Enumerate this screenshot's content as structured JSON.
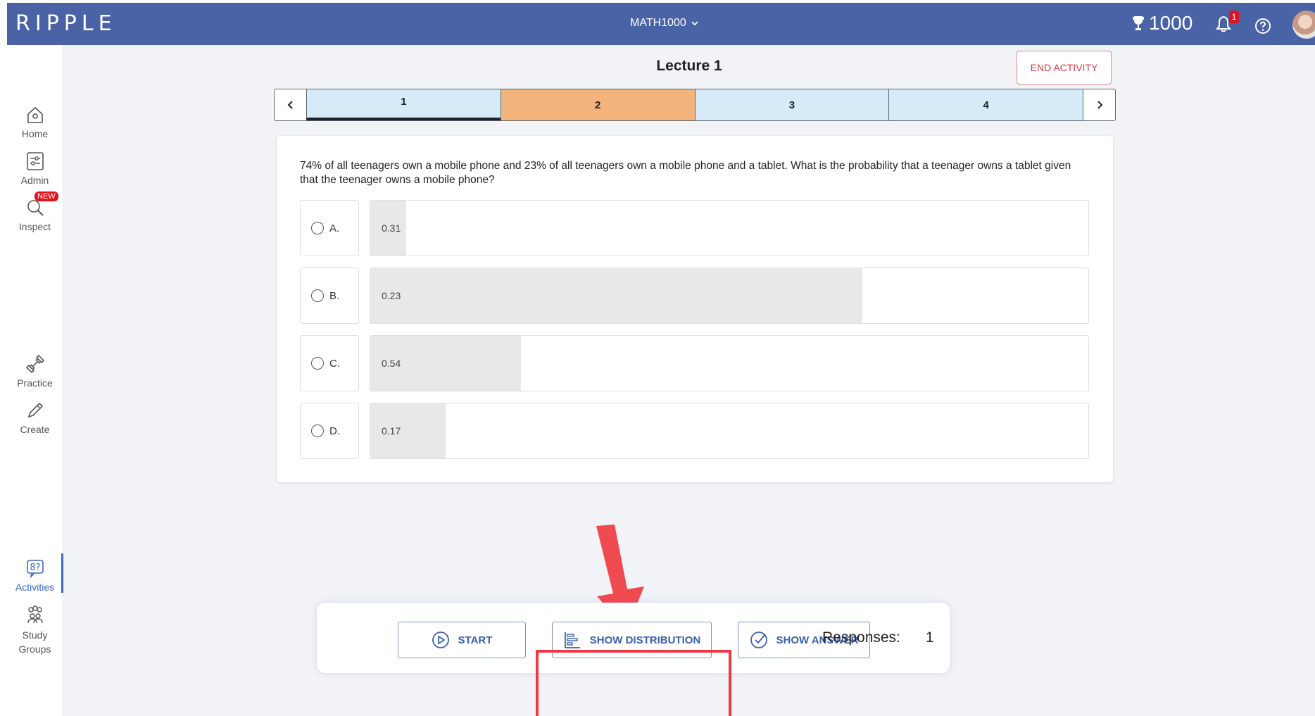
{
  "header": {
    "logo": "RIPPLE",
    "course": "MATH1000",
    "points": "1000",
    "notification_count": "1"
  },
  "sidebar": {
    "items": [
      {
        "label": "Home",
        "icon": "home-icon"
      },
      {
        "label": "Admin",
        "icon": "admin-icon"
      },
      {
        "label": "Inspect",
        "icon": "inspect-icon",
        "badge": "NEW"
      },
      {
        "label": "Practice",
        "icon": "practice-icon"
      },
      {
        "label": "Create",
        "icon": "create-icon"
      },
      {
        "label": "Activities",
        "icon": "activities-icon",
        "active": true
      },
      {
        "label": "Study Groups",
        "icon": "study-groups-icon"
      }
    ]
  },
  "main": {
    "title": "Lecture 1",
    "end_activity": "END ACTIVITY",
    "question_tabs": [
      "1",
      "2",
      "3",
      "4"
    ],
    "current_tab": "2",
    "question_text": "74% of all teenagers own a mobile phone and 23% of all teenagers own a mobile phone and a tablet. What is the probability that a teenager owns a tablet given that the teenager owns a mobile phone?",
    "options": [
      {
        "letter": "A.",
        "text": "0.31",
        "response_share": 0.05
      },
      {
        "letter": "B.",
        "text": "0.23",
        "response_share": 0.685
      },
      {
        "letter": "C.",
        "text": "0.54",
        "response_share": 0.21
      },
      {
        "letter": "D.",
        "text": "0.17",
        "response_share": 0.105
      }
    ]
  },
  "toolbar": {
    "start": "START",
    "show_distribution": "SHOW DISTRIBUTION",
    "show_answer": "SHOW ANSWER",
    "responses_label": "Responses:",
    "responses_count": "1"
  },
  "colors": {
    "header_bg": "#4a63a6",
    "current_tab": "#f2b47a",
    "tab_bg": "#d6eaf8",
    "highlight": "#ef3845"
  }
}
